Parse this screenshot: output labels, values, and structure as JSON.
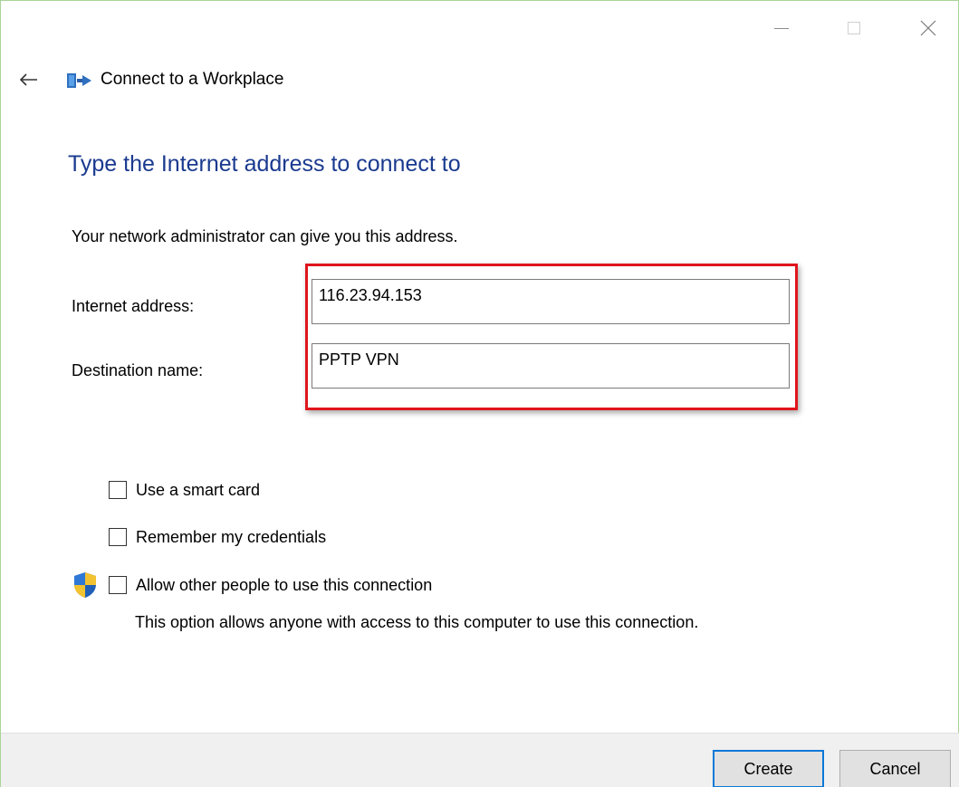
{
  "window": {
    "app_title": "Connect to a Workplace"
  },
  "page": {
    "heading": "Type the Internet address to connect to",
    "subtext": "Your network administrator can give you this address."
  },
  "form": {
    "address_label": "Internet address:",
    "address_value": "116.23.94.153",
    "destination_label": "Destination name:",
    "destination_value": "PPTP VPN"
  },
  "options": {
    "smart_card_label": "Use a smart card",
    "remember_label": "Remember my credentials",
    "allow_label": "Allow other people to use this connection",
    "allow_description": "This option allows anyone with access to this computer to use this connection."
  },
  "footer": {
    "create_label": "Create",
    "cancel_label": "Cancel"
  },
  "colors": {
    "heading": "#1a3a8f",
    "highlight": "#e0151c",
    "default_button_border": "#0a78d7",
    "footer_bg": "#f0f0f0"
  },
  "icons": {
    "back": "back-arrow-icon",
    "app": "network-connection-icon",
    "shield": "uac-shield-icon"
  }
}
